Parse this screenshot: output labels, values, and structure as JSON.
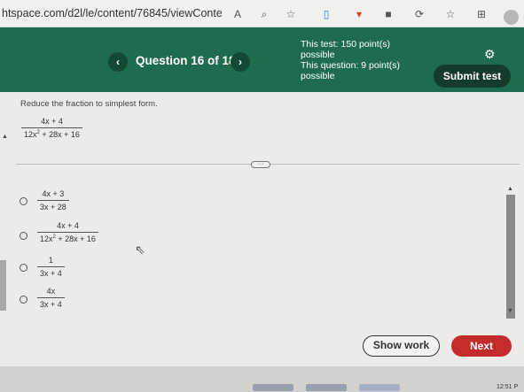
{
  "browser": {
    "url": "htspace.com/d2l/le/content/76845/viewContent/..."
  },
  "header": {
    "question_label": "Question 16 of 18",
    "prev_glyph": "‹",
    "next_glyph": "›",
    "test_points": "This test: 150 point(s) possible",
    "question_points": "This question: 9 point(s) possible",
    "submit_label": "Submit test",
    "bg_color": "#1f6b4e",
    "submit_color": "#163a2c"
  },
  "question": {
    "prompt": "Reduce the fraction to simplest form.",
    "fraction_num": "4x + 4",
    "fraction_den_a": "12x",
    "fraction_den_exp": "2",
    "fraction_den_b": " + 28x + 16"
  },
  "options": [
    {
      "num": "4x + 3",
      "den": "3x + 28"
    },
    {
      "num": "4x + 4",
      "den_a": "12x",
      "den_exp": "2",
      "den_b": " + 28x + 16"
    },
    {
      "num": "1",
      "den": "3x + 4"
    },
    {
      "num": "4x",
      "den": "3x + 4"
    }
  ],
  "actions": {
    "show_work_label": "Show work",
    "next_label": "Next",
    "next_color": "#c42c2c"
  },
  "taskbar": {
    "clock": "12:51 P"
  }
}
